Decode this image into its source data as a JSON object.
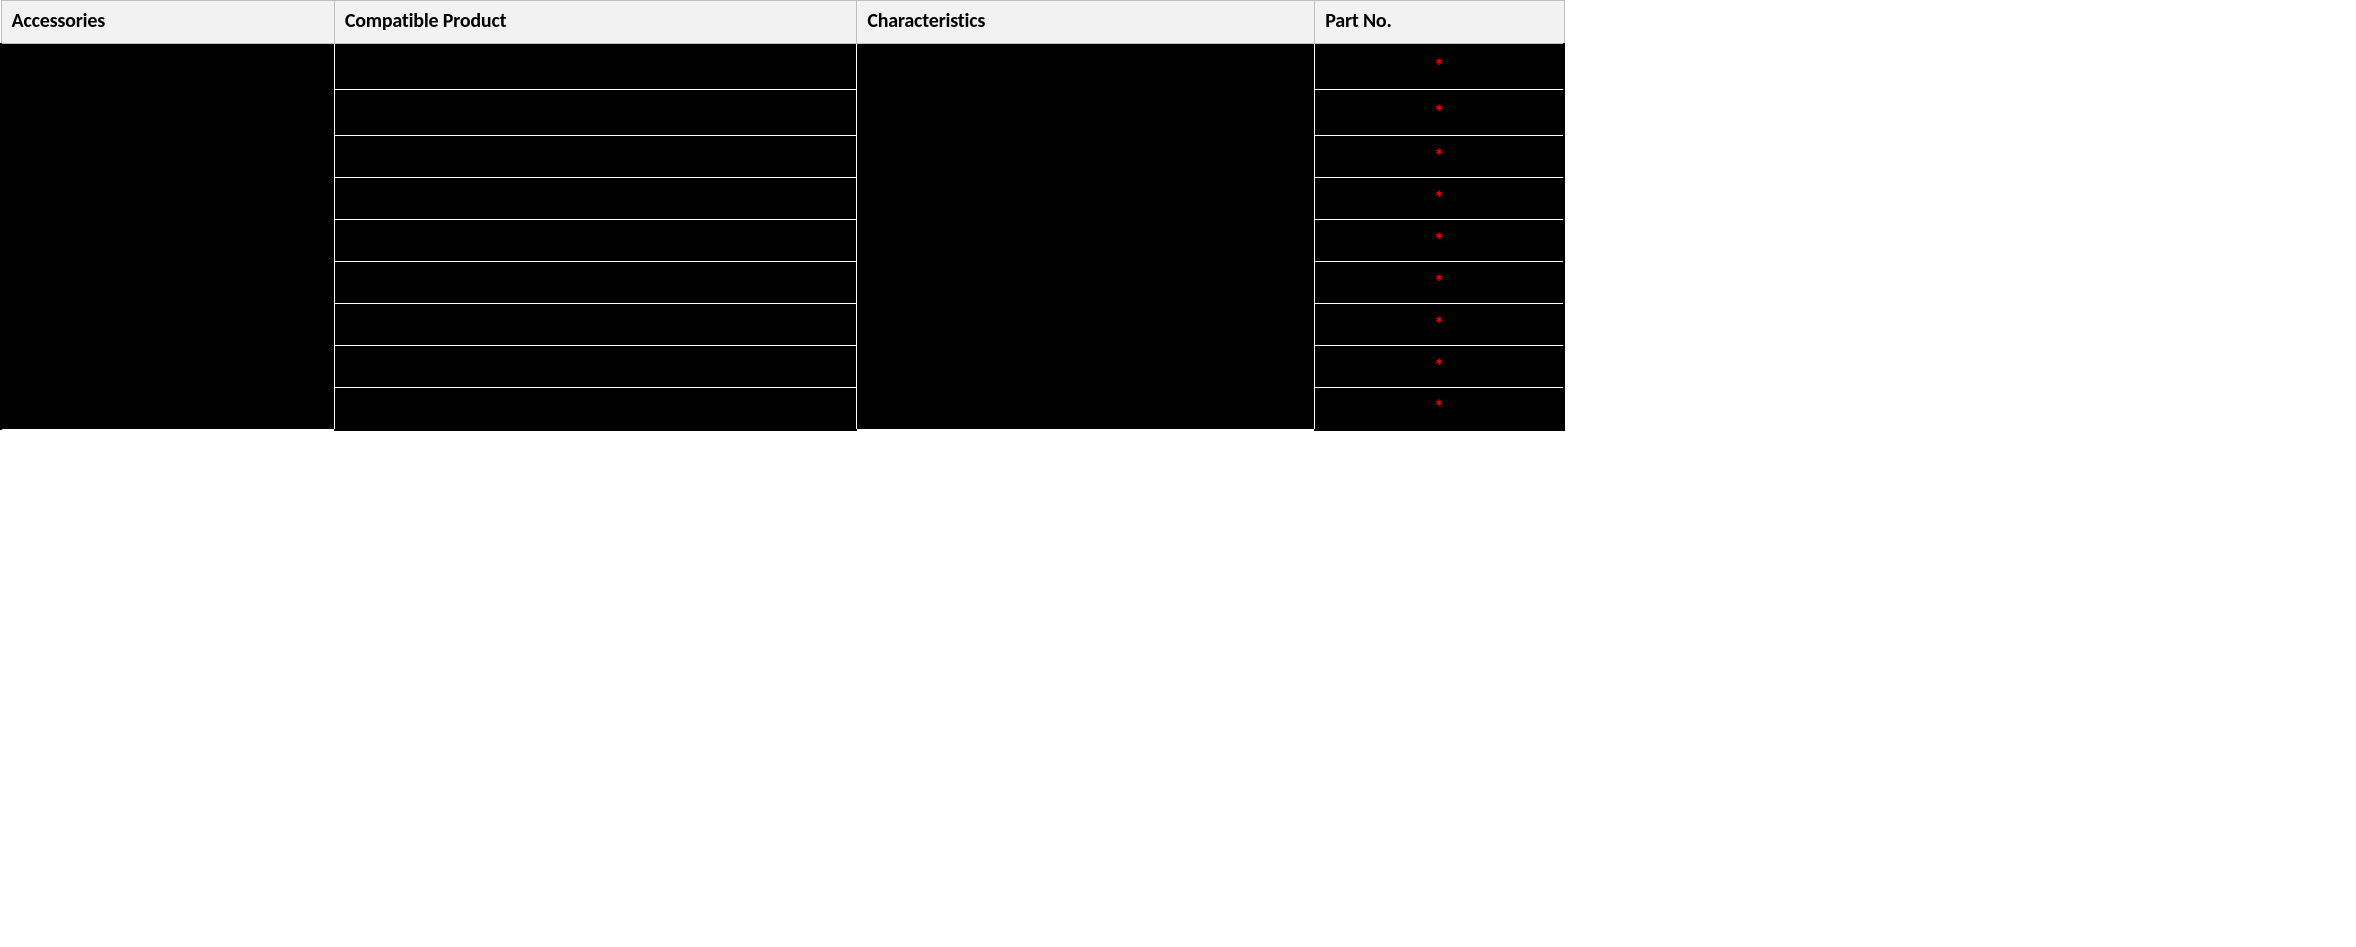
{
  "table": {
    "headers": [
      "Accessories",
      "Compatible Product",
      "Characteristics",
      "Part No."
    ],
    "rows": [
      {
        "accessories": "",
        "compatible": "",
        "characteristics": "",
        "part": "*"
      },
      {
        "accessories": "",
        "compatible": "",
        "characteristics": "",
        "part": "*"
      },
      {
        "accessories": "",
        "compatible": "",
        "characteristics": "",
        "part": "*"
      },
      {
        "accessories": "",
        "compatible": "",
        "characteristics": "",
        "part": "*"
      },
      {
        "accessories": "",
        "compatible": "",
        "characteristics": "",
        "part": "*"
      },
      {
        "accessories": "",
        "compatible": "",
        "characteristics": "",
        "part": "*"
      },
      {
        "accessories": "",
        "compatible": "",
        "characteristics": "",
        "part": "*"
      },
      {
        "accessories": "",
        "compatible": "",
        "characteristics": "",
        "part": "*"
      },
      {
        "accessories": "",
        "compatible": "",
        "characteristics": "",
        "part": "*"
      }
    ],
    "merged": {
      "accessories_rowspan": 9,
      "characteristics_rowspan": 9,
      "compatible_first_rowspan": 1
    }
  },
  "colors": {
    "header_bg": "#f2f2f2",
    "header_border": "#bfbfbf",
    "body_bg": "#000000",
    "body_border": "#ffffff",
    "asterisk": "#ff0000"
  }
}
